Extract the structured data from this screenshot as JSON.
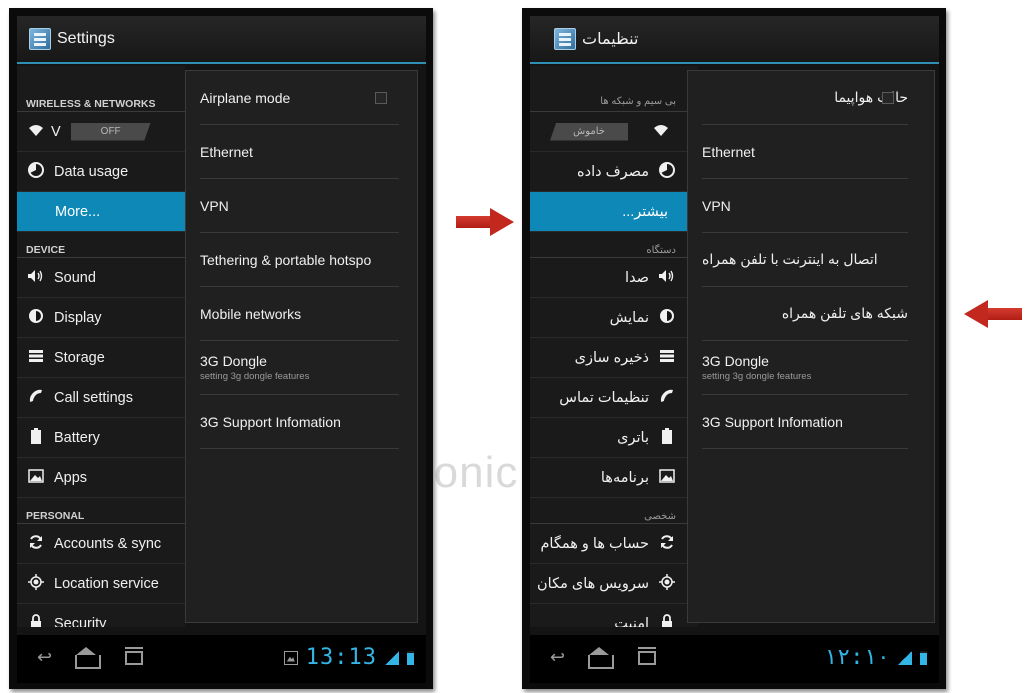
{
  "background_text": "ronic",
  "colors": {
    "accent": "#0e88b7",
    "clock": "#33b5e5",
    "arrow": "#c2281e",
    "actionbar_line": "#2f8fb4"
  },
  "english": {
    "title": "Settings",
    "sections": {
      "wireless": "WIRELESS & NETWORKS",
      "device": "DEVICE",
      "personal": "PERSONAL"
    },
    "wifi": {
      "label": "V",
      "toggle": "OFF"
    },
    "items": {
      "data_usage": "Data usage",
      "more": "More...",
      "sound": "Sound",
      "display": "Display",
      "storage": "Storage",
      "call_settings": "Call settings",
      "battery": "Battery",
      "apps": "Apps",
      "accounts": "Accounts & sync",
      "location": "Location service",
      "security": "Security"
    },
    "panel": {
      "airplane": "Airplane mode",
      "ethernet": "Ethernet",
      "vpn": "VPN",
      "tethering": "Tethering & portable hotspo",
      "mobile_networks": "Mobile networks",
      "dongle": "3G Dongle",
      "dongle_sub": "setting 3g dongle features",
      "support": "3G Support Infomation"
    },
    "clock": "13:13"
  },
  "persian": {
    "title": "تنظیمات",
    "sections": {
      "wireless": "بی سیم و شبکه ها",
      "device": "دستگاه",
      "personal": "شخصی"
    },
    "wifi": {
      "toggle": "خاموش"
    },
    "items": {
      "data_usage": "مصرف داده",
      "more": "بیشتر...",
      "sound": "صدا",
      "display": "نمایش",
      "storage": "ذخیره سازی",
      "call_settings": "تنظیمات تماس",
      "battery": "باتری",
      "apps": "برنامه‌ها",
      "accounts": "حساب ها و همگام",
      "location": "سرویس های مکان",
      "security": "امنیت"
    },
    "panel": {
      "airplane": "حالت هواپیما",
      "ethernet": "Ethernet",
      "vpn": "VPN",
      "tethering": "اتصال به اینترنت با تلفن همراه",
      "mobile_networks": "شبکه های تلفن همراه",
      "dongle": "3G Dongle",
      "dongle_sub": "setting 3g dongle features",
      "support": "3G Support Infomation"
    },
    "clock": "۱۲:۱۰"
  }
}
